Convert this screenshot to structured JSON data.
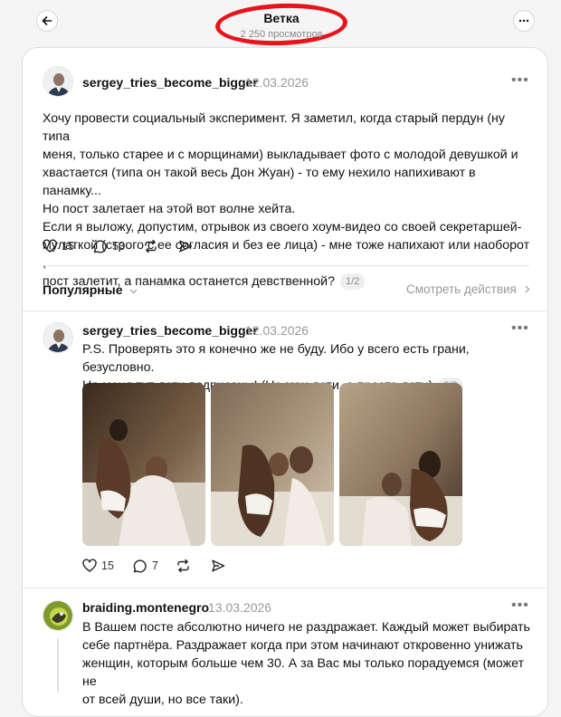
{
  "header": {
    "title": "Ветка",
    "views": "2 250 просмотров"
  },
  "post": {
    "username": "sergey_tries_become_bigger",
    "date": "12.03.2026",
    "lines": [
      "Хочу провести социальный эксперимент. Я заметил, когда старый пердун (ну типа",
      "меня, только старее и с морщинами) выкладывает фото с молодой девушкой и",
      "хвастается (типа он такой весь Дон Жуан) - то ему нехило напихивают в панамку...",
      "Но пост залетает на этой вот волне хейта.",
      "Если я выложу, допустим, отрывок из своего хоум-видео со своей секретаршей-",
      "мулаткой (строго с ее согласия и без ее лица) - мне тоже напихают или наоборот ,",
      "пост залетит, а панамка останется девственной?"
    ],
    "pager": "1/2",
    "likes": "15",
    "comments": "53"
  },
  "filter": {
    "sort_label": "Популярные",
    "activity_link": "Смотреть действия"
  },
  "reply1": {
    "username": "sergey_tries_become_bigger",
    "date": "12.03.2026",
    "lines": [
      "P.S. Проверять это я конечно же не буду. Ибо у всего есть грани, безусловно.",
      "На меня тут дети подписаны! (Не мои дети, а просто дети)"
    ],
    "pager": "2/2",
    "likes": "15",
    "comments": "7"
  },
  "reply2": {
    "username": "braiding.montenegro",
    "date": "13.03.2026",
    "lines": [
      "В Вашем посте абсолютно ничего не раздражает. Каждый может выбирать",
      "себе партнёра. Раздражает когда при этом начинают откровенно унижать",
      "женщин, которым больше чем 30. А за Вас мы только порадуемся (может не",
      "от всей души, но все таки)."
    ]
  },
  "icons": {
    "back": "arrow-left-icon",
    "menu": "more-horizontal-icon",
    "like": "heart-icon",
    "comment": "speech-bubble-icon",
    "repost": "repost-icon",
    "share": "send-icon"
  },
  "colors": {
    "highlight_circle": "#e8141a",
    "muted_text": "#9a9a9a",
    "background": "#f5f5f5"
  }
}
